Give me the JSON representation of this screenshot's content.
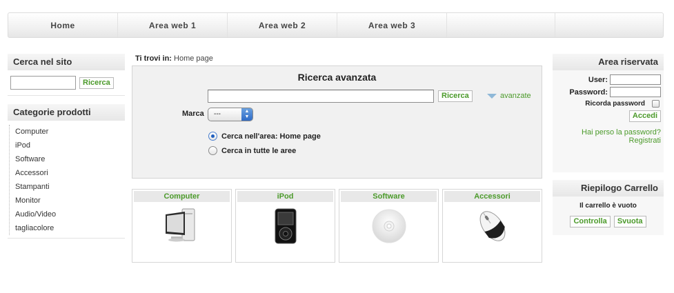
{
  "nav": {
    "items": [
      "Home",
      "Area web 1",
      "Area web 2",
      "Area web 3"
    ]
  },
  "search_site": {
    "title": "Cerca nel sito",
    "button": "Ricerca",
    "value": ""
  },
  "categories": {
    "title": "Categorie prodotti",
    "items": [
      "Computer",
      "iPod",
      "Software",
      "Accessori",
      "Stampanti",
      "Monitor",
      "Audio/Video",
      "tagliacolore"
    ]
  },
  "breadcrumb": {
    "label": "Ti trovi in:",
    "current": "Home page"
  },
  "advanced_search": {
    "title": "Ricerca avanzata",
    "button": "Ricerca",
    "more_link": "avanzate",
    "brand_label": "Marca",
    "brand_selected": "---",
    "radio_area": "Cerca nell'area: Home page",
    "radio_all": "Cerca in tutte le aree",
    "selected_radio": "area"
  },
  "products": [
    {
      "title": "Computer",
      "icon": "computer-icon"
    },
    {
      "title": "iPod",
      "icon": "ipod-icon"
    },
    {
      "title": "Software",
      "icon": "cd-icon"
    },
    {
      "title": "Accessori",
      "icon": "mouse-icon"
    }
  ],
  "login": {
    "title": "Area riservata",
    "user_label": "User:",
    "password_label": "Password:",
    "remember_label": "Ricorda password",
    "button": "Accedi",
    "lost_password": "Hai perso la password?",
    "register": "Registrati"
  },
  "cart": {
    "title": "Riepilogo Carrello",
    "status": "Il carrello è vuoto",
    "check_button": "Controlla",
    "empty_button": "Svuota"
  },
  "colors": {
    "accent_green": "#4b9a2a",
    "panel_gray": "#f1f1f1"
  }
}
